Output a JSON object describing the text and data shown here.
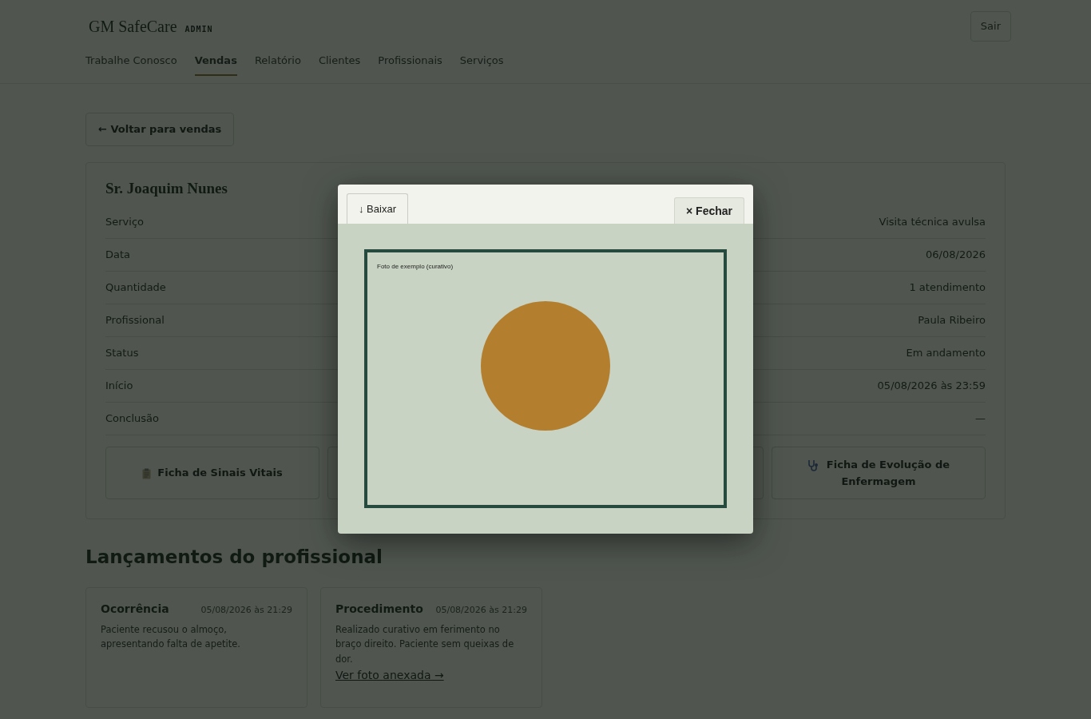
{
  "header": {
    "brand": "GM SafeCare",
    "role": "ADMIN",
    "logout": "Sair"
  },
  "nav": [
    {
      "label": "Trabalhe Conosco",
      "selected": false
    },
    {
      "label": "Vendas",
      "selected": true
    },
    {
      "label": "Relatório",
      "selected": false
    },
    {
      "label": "Clientes",
      "selected": false
    },
    {
      "label": "Profissionais",
      "selected": false
    },
    {
      "label": "Serviços",
      "selected": false
    }
  ],
  "back_button": "← Voltar para vendas",
  "sale": {
    "client": "Sr. Joaquim Nunes",
    "fields": [
      {
        "label": "Serviço",
        "value": "Visita técnica avulsa"
      },
      {
        "label": "Data",
        "value": "06/08/2026"
      },
      {
        "label": "Quantidade",
        "value": "1 atendimento"
      },
      {
        "label": "Profissional",
        "value": "Paula Ribeiro"
      },
      {
        "label": "Status",
        "value": "Em andamento"
      },
      {
        "label": "Início",
        "value": "05/08/2026 às 23:59"
      },
      {
        "label": "Conclusão",
        "value": "—"
      }
    ],
    "forms": [
      {
        "kind": "clipboard",
        "label": "Ficha de Sinais Vitais"
      },
      {
        "kind": "covered"
      },
      {
        "kind": "covered"
      },
      {
        "kind": "stethoscope",
        "label": "Ficha de Evolução de Enfermagem"
      }
    ]
  },
  "entries_title": "Lançamentos do profissional",
  "entries": [
    {
      "type": "Ocorrência",
      "time": "05/08/2026 às 21:29",
      "text": "Paciente recusou o almoço, apresentando falta de apetite."
    },
    {
      "type": "Procedimento",
      "time": "05/08/2026 às 21:29",
      "text": "Realizado curativo em ferimento no braço direito. Paciente sem queixas de dor.",
      "link": "Ver foto anexada →"
    }
  ],
  "modal": {
    "download": "↓ Baixar",
    "close": "× Fechar",
    "image_caption": "Foto de exemplo (curativo)"
  }
}
